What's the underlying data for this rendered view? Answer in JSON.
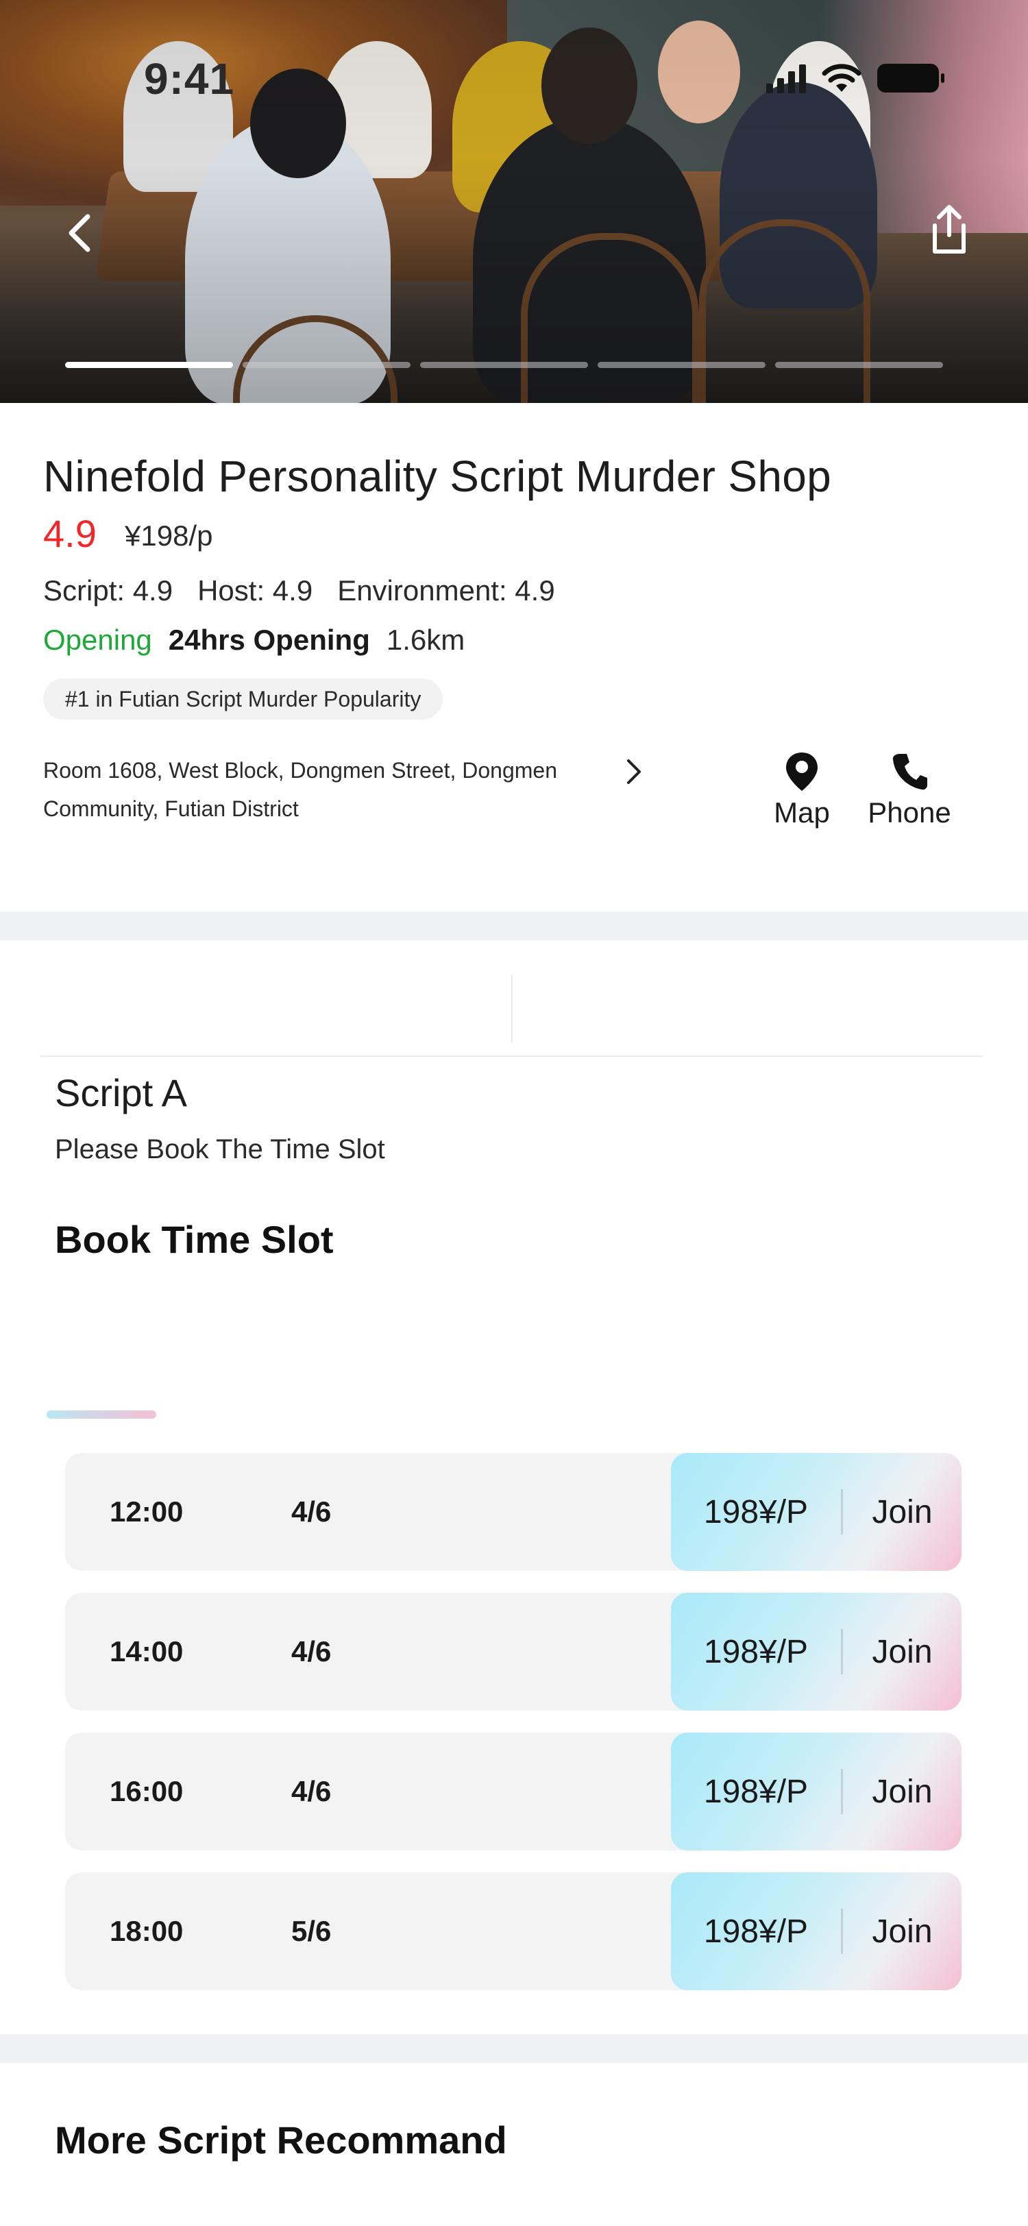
{
  "status_bar": {
    "time": "9:41"
  },
  "hero": {
    "pages": 5,
    "active_page": 1
  },
  "shop": {
    "name": "Ninefold Personality Script Murder Shop",
    "rating": "4.9",
    "price": "¥198/p",
    "scores": [
      "Script: 4.9",
      "Host: 4.9",
      "Environment: 4.9"
    ],
    "status": "Opening",
    "hours": "24hrs Opening",
    "distance": "1.6km",
    "rank_tag": "#1 in Futian Script Murder Popularity",
    "address": "Room 1608, West Block, Dongmen Street, Dongmen Community, Futian District",
    "map_label": "Map",
    "phone_label": "Phone"
  },
  "script": {
    "name": "Script A",
    "hint": "Please Book The Time Slot",
    "book_title": "Book Time Slot"
  },
  "slots": [
    {
      "time": "12:00",
      "count": "4/6",
      "price": "198¥/P",
      "action": "Join"
    },
    {
      "time": "14:00",
      "count": "4/6",
      "price": "198¥/P",
      "action": "Join"
    },
    {
      "time": "16:00",
      "count": "4/6",
      "price": "198¥/P",
      "action": "Join"
    },
    {
      "time": "18:00",
      "count": "5/6",
      "price": "198¥/P",
      "action": "Join"
    }
  ],
  "more": {
    "title": "More Script Recommand"
  },
  "colors": {
    "rating": "#f2262a",
    "open": "#1ea83a",
    "separator": "#f0f1f5"
  }
}
